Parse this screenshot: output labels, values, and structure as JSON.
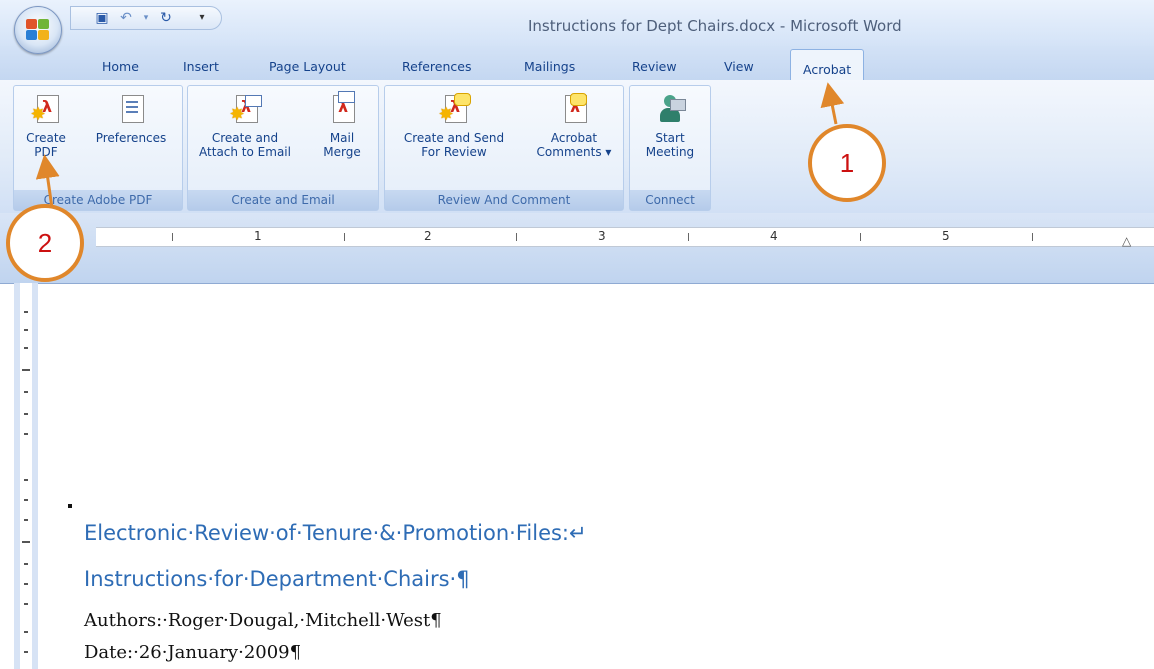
{
  "window": {
    "title": "Instructions for Dept Chairs.docx - Microsoft Word"
  },
  "quick_access": {
    "save_icon": "save-icon",
    "undo_icon": "undo-icon",
    "redo_icon": "redo-icon",
    "customize_icon": "customize-dropdown-icon"
  },
  "tabs": [
    {
      "label": "Home"
    },
    {
      "label": "Insert"
    },
    {
      "label": "Page Layout"
    },
    {
      "label": "References"
    },
    {
      "label": "Mailings"
    },
    {
      "label": "Review"
    },
    {
      "label": "View"
    },
    {
      "label": "Acrobat",
      "active": true
    }
  ],
  "ribbon": {
    "groups": [
      {
        "label": "Create Adobe PDF",
        "buttons": [
          {
            "line1": "Create",
            "line2": "PDF"
          },
          {
            "line1": "Preferences",
            "line2": ""
          }
        ]
      },
      {
        "label": "Create and Email",
        "buttons": [
          {
            "line1": "Create and",
            "line2": "Attach to Email"
          },
          {
            "line1": "Mail",
            "line2": "Merge"
          }
        ]
      },
      {
        "label": "Review And Comment",
        "buttons": [
          {
            "line1": "Create and Send",
            "line2": "For Review"
          },
          {
            "line1": "Acrobat",
            "line2": "Comments ▾"
          }
        ]
      },
      {
        "label": "Connect",
        "buttons": [
          {
            "line1": "Start",
            "line2": "Meeting"
          }
        ]
      }
    ]
  },
  "ruler": {
    "numbers": [
      "1",
      "2",
      "3",
      "4",
      "5"
    ]
  },
  "document": {
    "heading1": "Electronic·Review·of·Tenure·&·Promotion·Files:↵",
    "heading2": "Instructions·for·Department·Chairs·¶",
    "authors": "Authors:·Roger·Dougal,·Mitchell·West¶",
    "date": "Date:·26·January·2009¶"
  },
  "callouts": [
    {
      "number": "1"
    },
    {
      "number": "2"
    }
  ],
  "colors": {
    "accent_orange": "#e0872b",
    "callout_text": "#cc1010",
    "heading_blue": "#2e6cb5",
    "ribbon_text": "#15428b"
  }
}
